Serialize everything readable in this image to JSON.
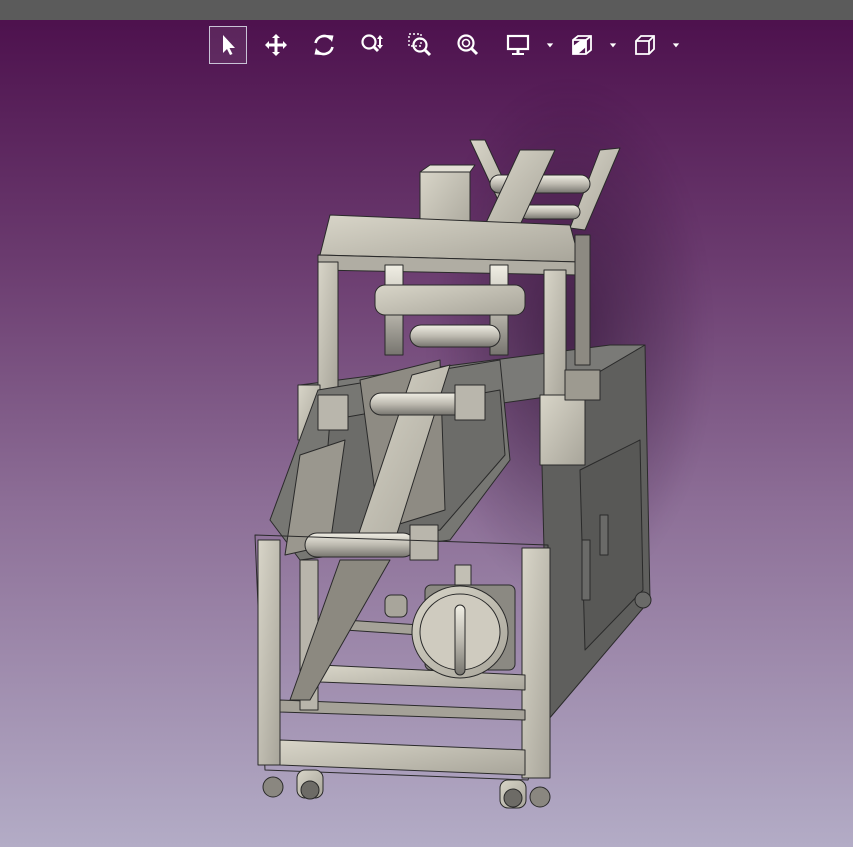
{
  "toolbar": {
    "tools": [
      {
        "id": "select",
        "icon": "arrow-cursor-icon",
        "active": true
      },
      {
        "id": "pan",
        "icon": "move-arrows-icon",
        "active": false
      },
      {
        "id": "rotate",
        "icon": "rotate-icon",
        "active": false
      },
      {
        "id": "zoom",
        "icon": "zoom-updown-icon",
        "active": false
      },
      {
        "id": "zoom-window",
        "icon": "zoom-window-icon",
        "active": false
      },
      {
        "id": "zoom-fit",
        "icon": "zoom-fit-icon",
        "active": false
      },
      {
        "id": "display",
        "icon": "monitor-icon",
        "has_dropdown": true
      },
      {
        "id": "section",
        "icon": "section-cube-icon",
        "has_dropdown": true
      },
      {
        "id": "view",
        "icon": "cube-view-icon",
        "has_dropdown": true
      }
    ]
  },
  "colors": {
    "titlebar": "#5b5b5b",
    "background_top": "#4b0e4b",
    "background_bottom": "#b3acc6",
    "model_light": "#c9c6b8",
    "model_dark": "#5f5f5d",
    "icon": "#ffffff"
  }
}
